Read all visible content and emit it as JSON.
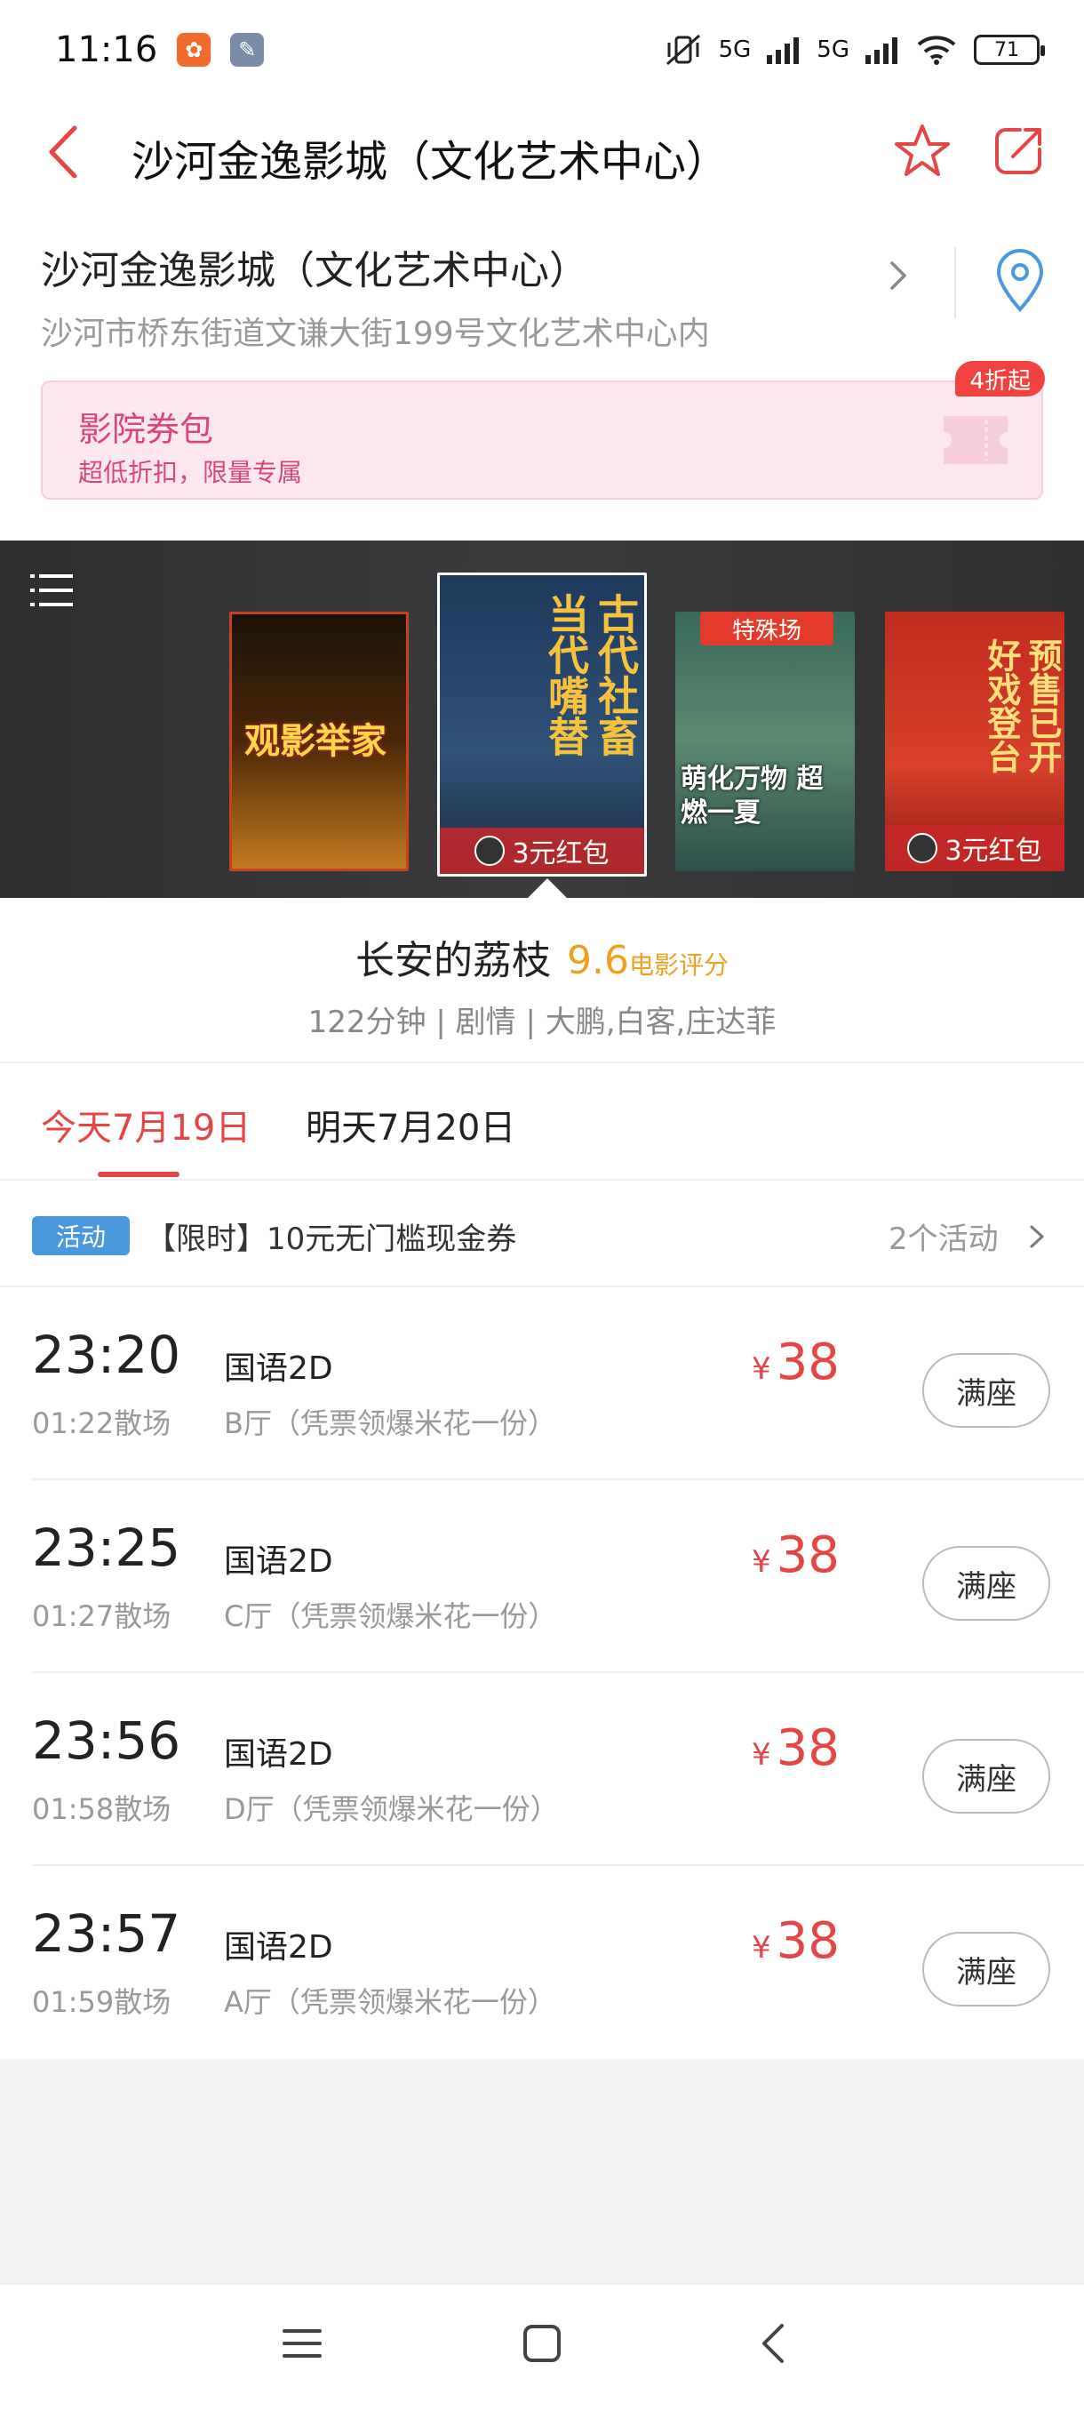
{
  "status_bar": {
    "time": "11:16",
    "net_1": "5G",
    "net_2": "5G",
    "battery": "71"
  },
  "header": {
    "title": "沙河金逸影城（文化艺术中心）"
  },
  "cinema": {
    "name": "沙河金逸影城（文化艺术中心）",
    "address": "沙河市桥东街道文谦大街199号文化艺术中心内"
  },
  "coupon": {
    "title": "影院券包",
    "subtitle": "超低折扣，限量专属",
    "badge": "4折起"
  },
  "posters": [
    {
      "title": "观影举家"
    },
    {
      "title": "古代社畜 当代嘴替",
      "redpack": "3元红包"
    },
    {
      "tag": "特殊场",
      "title": "萌化万物 超燃一夏"
    },
    {
      "title": "预售已开 好戏登台",
      "redpack": "3元红包"
    }
  ],
  "movie": {
    "title": "长安的荔枝",
    "score": "9.6",
    "score_label": "电影评分",
    "meta": "122分钟 | 剧情 | 大鹏,白客,庄达菲"
  },
  "dates": {
    "today": "今天7月19日",
    "tomorrow": "明天7月20日"
  },
  "activity": {
    "tag": "活动",
    "text": "【限时】10元无门槛现金券",
    "count": "2个活动"
  },
  "showtimes": [
    {
      "start": "23:20",
      "end": "01:22散场",
      "lang": "国语2D",
      "hall": "B厅（凭票领爆米花一份）",
      "currency": "¥",
      "price": "38",
      "status": "满座"
    },
    {
      "start": "23:25",
      "end": "01:27散场",
      "lang": "国语2D",
      "hall": "C厅（凭票领爆米花一份）",
      "currency": "¥",
      "price": "38",
      "status": "满座"
    },
    {
      "start": "23:56",
      "end": "01:58散场",
      "lang": "国语2D",
      "hall": "D厅（凭票领爆米花一份）",
      "currency": "¥",
      "price": "38",
      "status": "满座"
    },
    {
      "start": "23:57",
      "end": "01:59散场",
      "lang": "国语2D",
      "hall": "A厅（凭票领爆米花一份）",
      "currency": "¥",
      "price": "38",
      "status": "满座"
    }
  ],
  "colors": {
    "accent": "#e54545",
    "score": "#f0a020",
    "coupon_bg": "#fde7ef",
    "activity_tag": "#4a98dd"
  }
}
